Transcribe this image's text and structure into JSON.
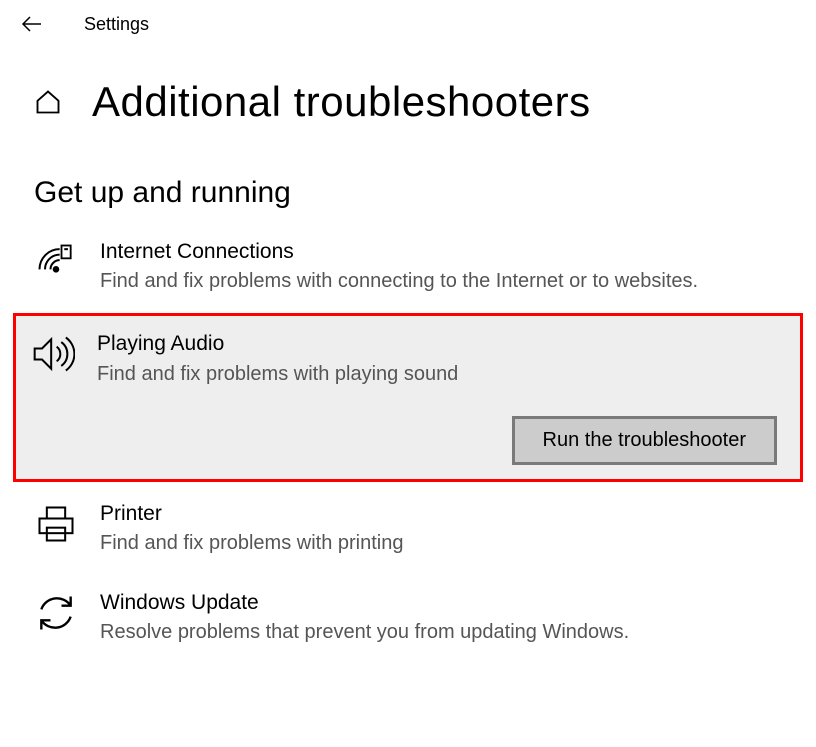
{
  "topBar": {
    "title": "Settings"
  },
  "pageTitle": "Additional troubleshooters",
  "sectionTitle": "Get up and running",
  "items": {
    "internet": {
      "title": "Internet Connections",
      "desc": "Find and fix problems with connecting to the Internet or to websites."
    },
    "audio": {
      "title": "Playing Audio",
      "desc": "Find and fix problems with playing sound",
      "actionLabel": "Run the troubleshooter"
    },
    "printer": {
      "title": "Printer",
      "desc": "Find and fix problems with printing"
    },
    "update": {
      "title": "Windows Update",
      "desc": "Resolve problems that prevent you from updating Windows."
    }
  }
}
